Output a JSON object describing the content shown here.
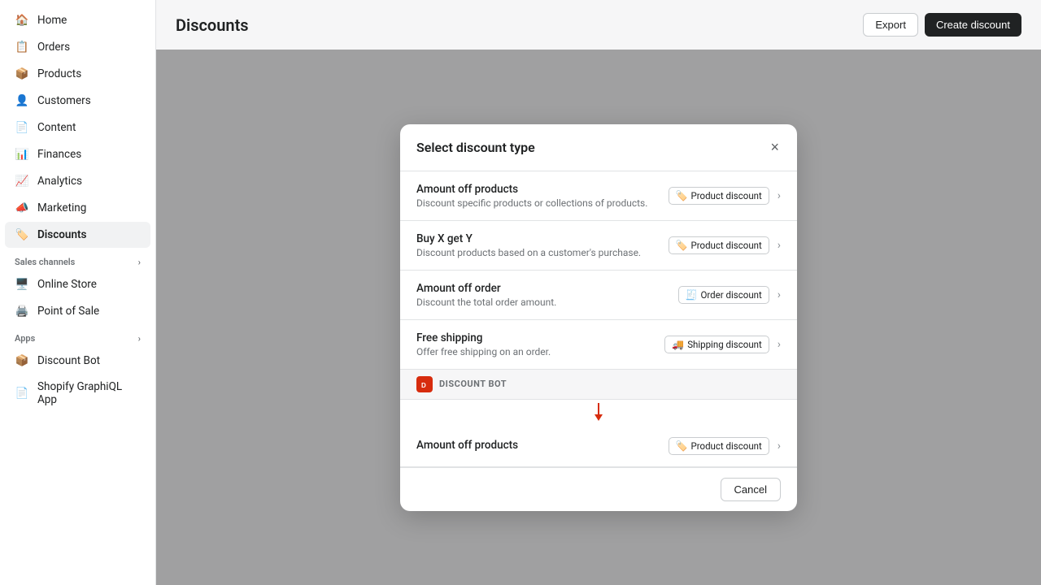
{
  "sidebar": {
    "items": [
      {
        "id": "home",
        "label": "Home",
        "icon": "🏠",
        "active": false
      },
      {
        "id": "orders",
        "label": "Orders",
        "icon": "📋",
        "active": false
      },
      {
        "id": "products",
        "label": "Products",
        "icon": "📦",
        "active": false
      },
      {
        "id": "customers",
        "label": "Customers",
        "icon": "👤",
        "active": false
      },
      {
        "id": "content",
        "label": "Content",
        "icon": "📄",
        "active": false
      },
      {
        "id": "finances",
        "label": "Finances",
        "icon": "📊",
        "active": false
      },
      {
        "id": "analytics",
        "label": "Analytics",
        "icon": "📈",
        "active": false
      },
      {
        "id": "marketing",
        "label": "Marketing",
        "icon": "📣",
        "active": false
      },
      {
        "id": "discounts",
        "label": "Discounts",
        "icon": "🏷️",
        "active": true
      }
    ],
    "sections": [
      {
        "label": "Sales channels",
        "items": [
          {
            "id": "online-store",
            "label": "Online Store",
            "icon": "🖥️"
          },
          {
            "id": "point-of-sale",
            "label": "Point of Sale",
            "icon": "🖨️"
          }
        ]
      },
      {
        "label": "Apps",
        "items": [
          {
            "id": "discount-bot",
            "label": "Discount Bot",
            "icon": "📦"
          },
          {
            "id": "shopify-graphiql",
            "label": "Shopify GraphiQL App",
            "icon": "📄"
          }
        ]
      }
    ]
  },
  "topbar": {
    "title": "Discounts",
    "export_label": "Export",
    "create_label": "Create discount"
  },
  "modal": {
    "title": "Select discount type",
    "close_label": "×",
    "options": [
      {
        "id": "amount-off-products",
        "title": "Amount off products",
        "description": "Discount specific products or collections of products.",
        "badge": "Product discount",
        "badge_icon": "🏷️"
      },
      {
        "id": "buy-x-get-y",
        "title": "Buy X get Y",
        "description": "Discount products based on a customer's purchase.",
        "badge": "Product discount",
        "badge_icon": "🏷️"
      },
      {
        "id": "amount-off-order",
        "title": "Amount off order",
        "description": "Discount the total order amount.",
        "badge": "Order discount",
        "badge_icon": "🧾"
      },
      {
        "id": "free-shipping",
        "title": "Free shipping",
        "description": "Offer free shipping on an order.",
        "badge": "Shipping discount",
        "badge_icon": "🚚"
      }
    ],
    "discount_bot_section_label": "DISCOUNT BOT",
    "discount_bot_option": {
      "id": "discount-bot-amount-off",
      "title": "Amount off products",
      "badge": "Product discount",
      "badge_icon": "🏷️"
    },
    "cancel_label": "Cancel"
  }
}
